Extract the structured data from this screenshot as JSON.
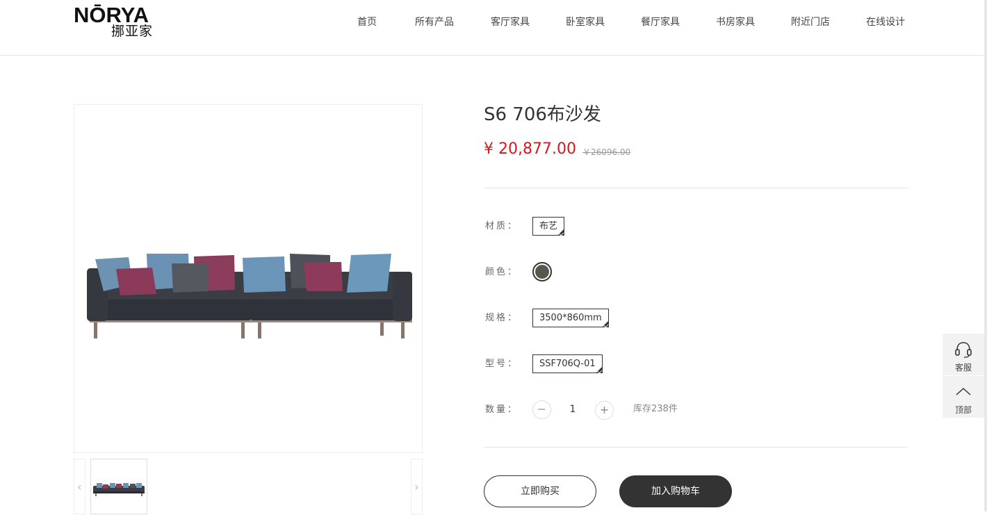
{
  "brand": {
    "name_en": "NŌRYA",
    "name_cn": "挪亚家"
  },
  "nav": [
    {
      "label": "首页"
    },
    {
      "label": "所有产品"
    },
    {
      "label": "客厅家具"
    },
    {
      "label": "卧室家具"
    },
    {
      "label": "餐厅家具"
    },
    {
      "label": "书房家具"
    },
    {
      "label": "附近门店"
    },
    {
      "label": "在线设计"
    }
  ],
  "product": {
    "title": "S6 706布沙发",
    "price": "¥ 20,877.00",
    "old_price": "￥26096.00"
  },
  "options": {
    "material": {
      "label": "材质：",
      "value": "布艺"
    },
    "color": {
      "label": "颜色：",
      "swatch_color": "#55594d"
    },
    "size": {
      "label": "规格：",
      "value": "3500*860mm"
    },
    "model": {
      "label": "型号：",
      "value": "SSF706Q-01"
    },
    "quantity": {
      "label": "数量：",
      "value": "1",
      "minus": "−",
      "plus": "+",
      "stock": "库存238件"
    }
  },
  "gallery": {
    "prev": "‹",
    "next": "›"
  },
  "actions": {
    "buy_now": "立即购买",
    "add_to_cart": "加入购物车"
  },
  "side_tools": {
    "service": "客服",
    "top": "顶部"
  },
  "colors": {
    "accent_price": "#d9161c",
    "dark_button": "#333333",
    "sofa_body": "#3a3d44"
  }
}
